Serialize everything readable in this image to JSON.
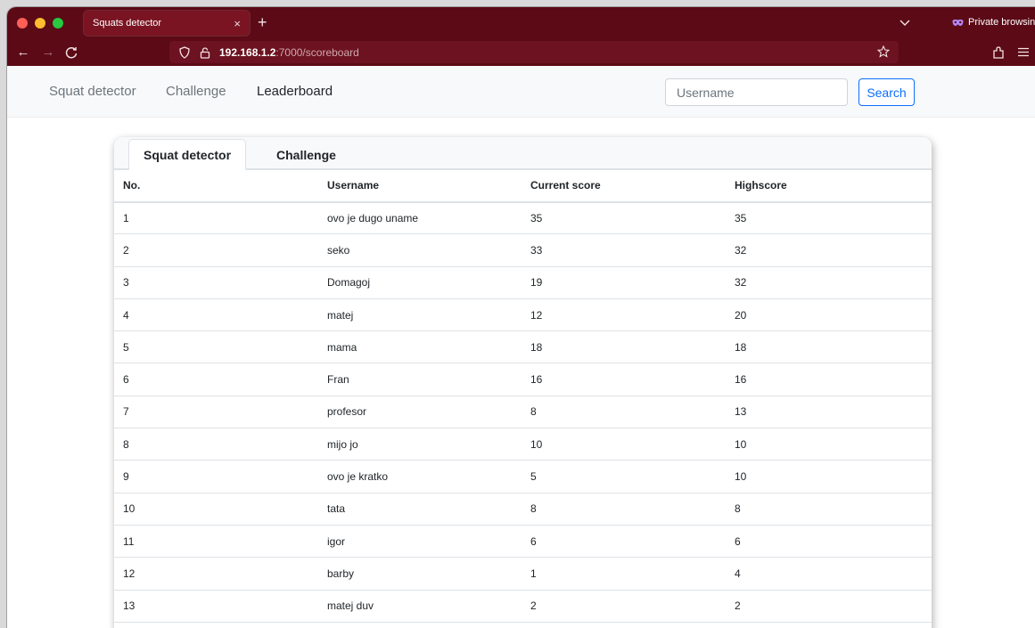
{
  "browser": {
    "tab_title": "Squats detector",
    "tab_close": "×",
    "new_tab": "+",
    "private_label": "Private browsing",
    "url_host": "192.168.1.2",
    "url_path": ":7000/scoreboard",
    "colors": {
      "chrome": "#5b0a16",
      "urlbar": "#6d1220"
    }
  },
  "topnav": {
    "brand": "Squat detector",
    "links": [
      {
        "label": "Challenge"
      },
      {
        "label": "Leaderboard"
      }
    ],
    "search": {
      "placeholder": "Username",
      "button": "Search"
    }
  },
  "leaderboard": {
    "tabs": [
      {
        "label": "Squat detector",
        "active": true
      },
      {
        "label": "Challenge",
        "active": false
      }
    ],
    "columns": [
      "No.",
      "Username",
      "Current score",
      "Highscore"
    ],
    "rows": [
      [
        "1",
        "ovo je dugo uname",
        "35",
        "35"
      ],
      [
        "2",
        "seko",
        "33",
        "32"
      ],
      [
        "3",
        "Domagoj",
        "19",
        "32"
      ],
      [
        "4",
        "matej",
        "12",
        "20"
      ],
      [
        "5",
        "mama",
        "18",
        "18"
      ],
      [
        "6",
        "Fran",
        "16",
        "16"
      ],
      [
        "7",
        "profesor",
        "8",
        "13"
      ],
      [
        "8",
        "mijo jo",
        "10",
        "10"
      ],
      [
        "9",
        "ovo je kratko",
        "5",
        "10"
      ],
      [
        "10",
        "tata",
        "8",
        "8"
      ],
      [
        "11",
        "igor",
        "6",
        "6"
      ],
      [
        "12",
        "barby",
        "1",
        "4"
      ],
      [
        "13",
        "matej duv",
        "2",
        "2"
      ]
    ]
  }
}
